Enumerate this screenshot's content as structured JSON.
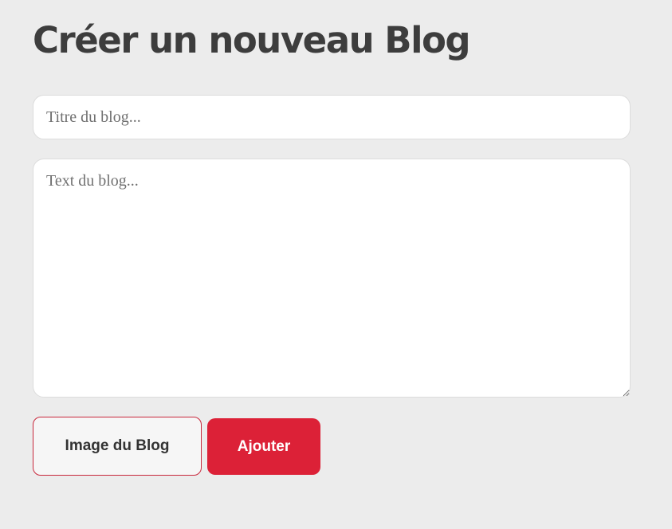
{
  "page": {
    "title": "Créer un nouveau Blog"
  },
  "form": {
    "title_field": {
      "value": "",
      "placeholder": "Titre du blog..."
    },
    "text_field": {
      "value": "",
      "placeholder": "Text du blog..."
    },
    "image_button_label": "Image du Blog",
    "submit_button_label": "Ajouter"
  },
  "colors": {
    "background": "#ececec",
    "title_text": "#3d3d3d",
    "accent_red": "#dc2137",
    "image_button_border": "#c8283c"
  }
}
